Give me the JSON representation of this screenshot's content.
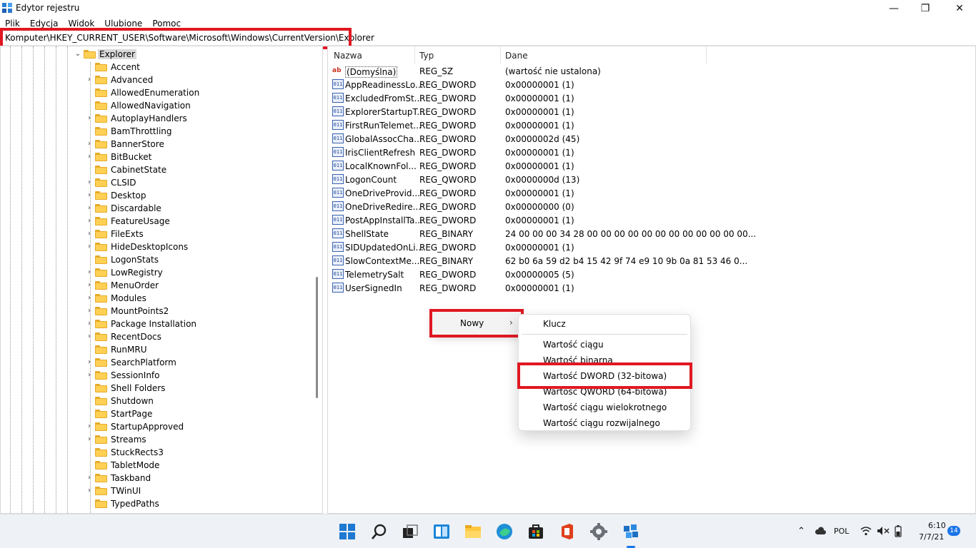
{
  "window": {
    "title": "Edytor rejestru",
    "minimize": "—",
    "maximize": "❐",
    "close": "✕"
  },
  "menu": [
    "Plik",
    "Edycja",
    "Widok",
    "Ulubione",
    "Pomoc"
  ],
  "address": "Komputer\\HKEY_CURRENT_USER\\Software\\Microsoft\\Windows\\CurrentVersion\\Explorer",
  "tree": {
    "selected": "Explorer",
    "items": [
      {
        "label": "Accent",
        "expandable": false
      },
      {
        "label": "Advanced",
        "expandable": true
      },
      {
        "label": "AllowedEnumeration",
        "expandable": false
      },
      {
        "label": "AllowedNavigation",
        "expandable": false
      },
      {
        "label": "AutoplayHandlers",
        "expandable": true
      },
      {
        "label": "BamThrottling",
        "expandable": false
      },
      {
        "label": "BannerStore",
        "expandable": true
      },
      {
        "label": "BitBucket",
        "expandable": true
      },
      {
        "label": "CabinetState",
        "expandable": false
      },
      {
        "label": "CLSID",
        "expandable": true
      },
      {
        "label": "Desktop",
        "expandable": true
      },
      {
        "label": "Discardable",
        "expandable": true
      },
      {
        "label": "FeatureUsage",
        "expandable": true
      },
      {
        "label": "FileExts",
        "expandable": true
      },
      {
        "label": "HideDesktopIcons",
        "expandable": true
      },
      {
        "label": "LogonStats",
        "expandable": false
      },
      {
        "label": "LowRegistry",
        "expandable": true
      },
      {
        "label": "MenuOrder",
        "expandable": true
      },
      {
        "label": "Modules",
        "expandable": true
      },
      {
        "label": "MountPoints2",
        "expandable": true
      },
      {
        "label": "Package Installation",
        "expandable": true
      },
      {
        "label": "RecentDocs",
        "expandable": true
      },
      {
        "label": "RunMRU",
        "expandable": false
      },
      {
        "label": "SearchPlatform",
        "expandable": true
      },
      {
        "label": "SessionInfo",
        "expandable": true
      },
      {
        "label": "Shell Folders",
        "expandable": false
      },
      {
        "label": "Shutdown",
        "expandable": false
      },
      {
        "label": "StartPage",
        "expandable": false
      },
      {
        "label": "StartupApproved",
        "expandable": true
      },
      {
        "label": "Streams",
        "expandable": true
      },
      {
        "label": "StuckRects3",
        "expandable": false
      },
      {
        "label": "TabletMode",
        "expandable": false
      },
      {
        "label": "Taskband",
        "expandable": true
      },
      {
        "label": "TWinUI",
        "expandable": true
      },
      {
        "label": "TypedPaths",
        "expandable": false
      }
    ]
  },
  "columns": {
    "name": "Nazwa",
    "type": "Typ",
    "data": "Dane"
  },
  "values": [
    {
      "name": "(Domyślna)",
      "type": "REG_SZ",
      "data": "(wartość nie ustalona)",
      "icon": "string-value-icon"
    },
    {
      "name": "AppReadinessLo...",
      "type": "REG_DWORD",
      "data": "0x00000001 (1)",
      "icon": "binary-value-icon"
    },
    {
      "name": "ExcludedFromSt...",
      "type": "REG_DWORD",
      "data": "0x00000001 (1)",
      "icon": "binary-value-icon"
    },
    {
      "name": "ExplorerStartupT...",
      "type": "REG_DWORD",
      "data": "0x00000001 (1)",
      "icon": "binary-value-icon"
    },
    {
      "name": "FirstRunTelemet...",
      "type": "REG_DWORD",
      "data": "0x00000001 (1)",
      "icon": "binary-value-icon"
    },
    {
      "name": "GlobalAssocCha...",
      "type": "REG_DWORD",
      "data": "0x0000002d (45)",
      "icon": "binary-value-icon"
    },
    {
      "name": "IrisClientRefresh",
      "type": "REG_DWORD",
      "data": "0x00000001 (1)",
      "icon": "binary-value-icon"
    },
    {
      "name": "LocalKnownFol...",
      "type": "REG_DWORD",
      "data": "0x00000001 (1)",
      "icon": "binary-value-icon"
    },
    {
      "name": "LogonCount",
      "type": "REG_QWORD",
      "data": "0x0000000d (13)",
      "icon": "binary-value-icon"
    },
    {
      "name": "OneDriveProvid...",
      "type": "REG_DWORD",
      "data": "0x00000001 (1)",
      "icon": "binary-value-icon"
    },
    {
      "name": "OneDriveRedire...",
      "type": "REG_DWORD",
      "data": "0x00000000 (0)",
      "icon": "binary-value-icon"
    },
    {
      "name": "PostAppInstallTa...",
      "type": "REG_DWORD",
      "data": "0x00000001 (1)",
      "icon": "binary-value-icon"
    },
    {
      "name": "ShellState",
      "type": "REG_BINARY",
      "data": "24 00 00 00 34 28 00 00 00 00 00 00 00 00 00 00 00 00...",
      "icon": "binary-value-icon"
    },
    {
      "name": "SIDUpdatedOnLi...",
      "type": "REG_DWORD",
      "data": "0x00000001 (1)",
      "icon": "binary-value-icon"
    },
    {
      "name": "SlowContextMe...",
      "type": "REG_BINARY",
      "data": "62 b0 6a 59 d2 b4 15 42 9f 74 e9 10 9b 0a 81 53 46 0...",
      "icon": "binary-value-icon"
    },
    {
      "name": "TelemetrySalt",
      "type": "REG_DWORD",
      "data": "0x00000005 (5)",
      "icon": "binary-value-icon"
    },
    {
      "name": "UserSignedIn",
      "type": "REG_DWORD",
      "data": "0x00000001 (1)",
      "icon": "binary-value-icon"
    }
  ],
  "context_menu": {
    "new_label": "Nowy",
    "submenu": [
      "Klucz",
      "Wartość ciągu",
      "Wartość binarna",
      "Wartość DWORD (32-bitowa)",
      "Wartość QWORD (64-bitowa)",
      "Wartość ciągu wielokrotnego",
      "Wartość ciągu rozwijalnego"
    ]
  },
  "taskbar": {
    "language": "POL",
    "time": "6:10",
    "date": "7/7/21",
    "notifications": "14"
  },
  "colors": {
    "highlight": "#e01822",
    "folder": "#ffd054",
    "taskbar": "#eef1f6"
  }
}
